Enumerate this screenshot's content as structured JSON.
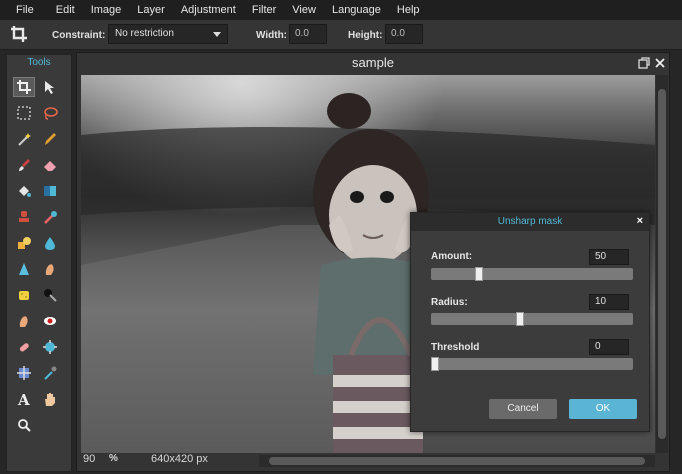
{
  "menu": [
    "File",
    "Edit",
    "Image",
    "Layer",
    "Adjustment",
    "Filter",
    "View",
    "Language",
    "Help"
  ],
  "options": {
    "constraint_label": "Constraint:",
    "constraint_value": "No restriction",
    "width_label": "Width:",
    "width_value": "0.0",
    "height_label": "Height:",
    "height_value": "0.0"
  },
  "tools": {
    "title": "Tools",
    "items": [
      "crop",
      "move",
      "marquee",
      "lasso",
      "magic-wand",
      "pencil",
      "brush",
      "eraser",
      "bucket",
      "gradient",
      "clone-stamp",
      "color-replace",
      "draw-shape",
      "blur",
      "sharpen",
      "smudge",
      "sponge",
      "dodge",
      "burn",
      "red-eye",
      "spot-heal",
      "bloat",
      "pinch",
      "color-picker",
      "type",
      "hand",
      "zoom"
    ]
  },
  "canvas": {
    "title": "sample",
    "zoom_value": "90",
    "zoom_unit": "%",
    "dimensions": "640x420 px"
  },
  "dialog": {
    "title": "Unsharp mask",
    "close": "×",
    "params": [
      {
        "label": "Amount:",
        "value": "50",
        "fraction": 0.24
      },
      {
        "label": "Radius:",
        "value": "10",
        "fraction": 0.44
      },
      {
        "label": "Threshold",
        "value": "0",
        "fraction": 0.0
      }
    ],
    "cancel_label": "Cancel",
    "ok_label": "OK"
  },
  "colors": {
    "accent": "#4fb8d6",
    "ok_button": "#5ab4d4",
    "menubar": "#1f1f1f",
    "panel": "#3a3a3a"
  }
}
